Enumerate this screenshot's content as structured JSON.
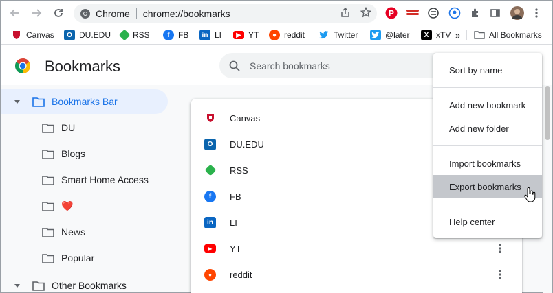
{
  "omnibox": {
    "site_name": "Chrome",
    "url": "chrome://bookmarks"
  },
  "bookmarks_bar": {
    "items": [
      {
        "label": "Canvas",
        "icon": "canvas-icon",
        "color": "#c8102e"
      },
      {
        "label": "DU.EDU",
        "icon": "outlook-icon",
        "color": "#0a64ad"
      },
      {
        "label": "RSS",
        "icon": "feedly-icon",
        "color": "#2bb24c"
      },
      {
        "label": "FB",
        "icon": "facebook-icon",
        "color": "#1877f2"
      },
      {
        "label": "LI",
        "icon": "linkedin-icon",
        "color": "#0a66c2"
      },
      {
        "label": "YT",
        "icon": "youtube-icon",
        "color": "#ff0000"
      },
      {
        "label": "reddit",
        "icon": "reddit-icon",
        "color": "#ff4500"
      },
      {
        "label": "Twitter",
        "icon": "twitter-icon",
        "color": "#1d9bf0"
      },
      {
        "label": "@later",
        "icon": "twitter-icon",
        "color": "#1d9bf0"
      },
      {
        "label": "xTV",
        "icon": "x-icon",
        "color": "#000000"
      }
    ],
    "overflow": "»",
    "all_bookmarks": "All Bookmarks"
  },
  "header": {
    "title": "Bookmarks",
    "search_placeholder": "Search bookmarks"
  },
  "tree": {
    "items": [
      {
        "label": "Bookmarks Bar",
        "expanded": true,
        "selected": true
      },
      {
        "label": "DU"
      },
      {
        "label": "Blogs"
      },
      {
        "label": "Smart Home Access"
      },
      {
        "label": "❤️"
      },
      {
        "label": "News"
      },
      {
        "label": "Popular"
      },
      {
        "label": "Other Bookmarks",
        "expanded": false
      }
    ]
  },
  "list": {
    "rows": [
      {
        "label": "Canvas",
        "icon": "canvas-icon",
        "color": "#c8102e"
      },
      {
        "label": "DU.EDU",
        "icon": "outlook-icon",
        "color": "#0a64ad"
      },
      {
        "label": "RSS",
        "icon": "feedly-icon",
        "color": "#2bb24c"
      },
      {
        "label": "FB",
        "icon": "facebook-icon",
        "color": "#1877f2"
      },
      {
        "label": "LI",
        "icon": "linkedin-icon",
        "color": "#0a66c2"
      },
      {
        "label": "YT",
        "icon": "youtube-icon",
        "color": "#ff0000"
      },
      {
        "label": "reddit",
        "icon": "reddit-icon",
        "color": "#ff4500"
      }
    ]
  },
  "menu": {
    "items": [
      {
        "label": "Sort by name"
      },
      {
        "label": "Add new bookmark"
      },
      {
        "label": "Add new folder"
      },
      {
        "label": "Import bookmarks"
      },
      {
        "label": "Export bookmarks",
        "hovered": true
      },
      {
        "label": "Help center"
      }
    ]
  },
  "colors": {
    "accent": "#1a73e8",
    "selected_bg": "#e8f0fe",
    "hover_bg": "#c4c7cc"
  }
}
